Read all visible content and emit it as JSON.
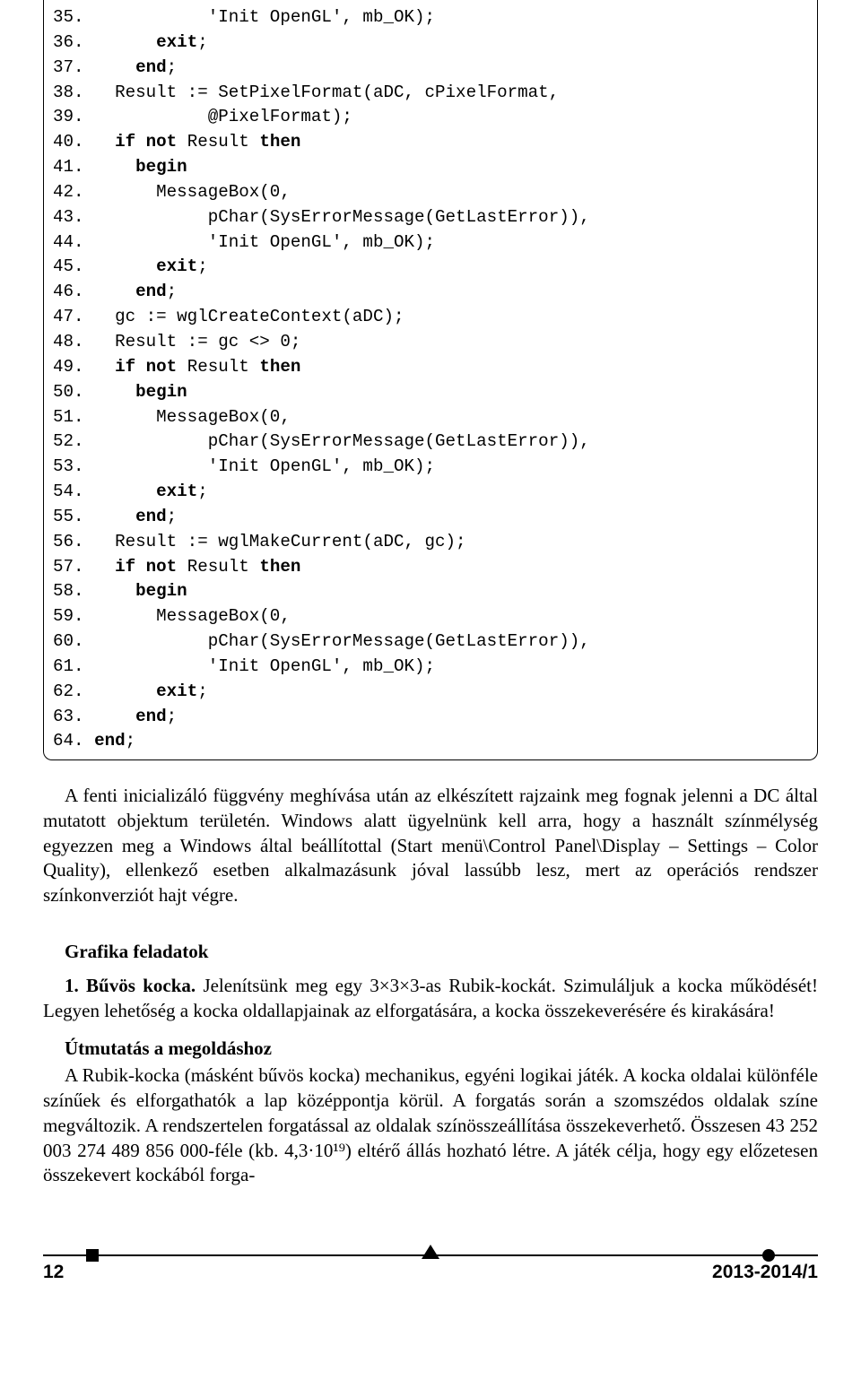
{
  "code": {
    "lines": [
      {
        "n": "35.",
        "i": "            ",
        "t": "'Init OpenGL', mb_OK);"
      },
      {
        "n": "36.",
        "i": "       ",
        "k": "exit",
        "t": ";"
      },
      {
        "n": "37.",
        "i": "     ",
        "k": "end",
        "t": ";"
      },
      {
        "n": "38.",
        "i": "   ",
        "t": "Result := SetPixelFormat(aDC, cPixelFormat,"
      },
      {
        "n": "39.",
        "i": "            ",
        "t": "@PixelFormat);"
      },
      {
        "n": "40.",
        "i": "   ",
        "pre": "if not ",
        "mid": "Result ",
        "k": "then"
      },
      {
        "n": "41.",
        "i": "     ",
        "k": "begin"
      },
      {
        "n": "42.",
        "i": "       ",
        "t": "MessageBox(0,"
      },
      {
        "n": "43.",
        "i": "            ",
        "t": "pChar(SysErrorMessage(GetLastError)),"
      },
      {
        "n": "44.",
        "i": "            ",
        "t": "'Init OpenGL', mb_OK);"
      },
      {
        "n": "45.",
        "i": "       ",
        "k": "exit",
        "t": ";"
      },
      {
        "n": "46.",
        "i": "     ",
        "k": "end",
        "t": ";"
      },
      {
        "n": "47.",
        "i": "   ",
        "t": "gc := wglCreateContext(aDC);"
      },
      {
        "n": "48.",
        "i": "   ",
        "t": "Result := gc <> 0;"
      },
      {
        "n": "49.",
        "i": "   ",
        "pre": "if not ",
        "mid": "Result ",
        "k": "then"
      },
      {
        "n": "50.",
        "i": "     ",
        "k": "begin"
      },
      {
        "n": "51.",
        "i": "       ",
        "t": "MessageBox(0,"
      },
      {
        "n": "52.",
        "i": "            ",
        "t": "pChar(SysErrorMessage(GetLastError)),"
      },
      {
        "n": "53.",
        "i": "            ",
        "t": "'Init OpenGL', mb_OK);"
      },
      {
        "n": "54.",
        "i": "       ",
        "k": "exit",
        "t": ";"
      },
      {
        "n": "55.",
        "i": "     ",
        "k": "end",
        "t": ";"
      },
      {
        "n": "56.",
        "i": "   ",
        "t": "Result := wglMakeCurrent(aDC, gc);"
      },
      {
        "n": "57.",
        "i": "   ",
        "pre": "if not ",
        "mid": "Result ",
        "k": "then"
      },
      {
        "n": "58.",
        "i": "     ",
        "k": "begin"
      },
      {
        "n": "59.",
        "i": "       ",
        "t": "MessageBox(0,"
      },
      {
        "n": "60.",
        "i": "            ",
        "t": "pChar(SysErrorMessage(GetLastError)),"
      },
      {
        "n": "61.",
        "i": "            ",
        "t": "'Init OpenGL', mb_OK);"
      },
      {
        "n": "62.",
        "i": "       ",
        "k": "exit",
        "t": ";"
      },
      {
        "n": "63.",
        "i": "     ",
        "k": "end",
        "t": ";"
      },
      {
        "n": "64.",
        "i": " ",
        "k": "end",
        "t": ";"
      }
    ]
  },
  "para1": "A fenti inicializáló függvény meghívása után az elkészített rajzaink meg fognak jelenni a DC által mutatott objektum területén. Windows alatt ügyelnünk kell arra, hogy a használt színmélység egyezzen meg a Windows által beállítottal (Start menü\\Control Panel\\Display – Settings – Color Quality), ellenkező esetben alkalmazásunk jóval lassúbb lesz, mert az operációs rendszer színkonverziót hajt végre.",
  "section": "Grafika feladatok",
  "task_lead": "1. Bűvös kocka.",
  "task_rest": " Jelenítsünk meg egy 3×3×3-as Rubik-kockát. Szimuláljuk a kocka működését! Legyen lehetőség a kocka oldallapjainak az elforgatására, a kocka összekeverésére és kirakására!",
  "subhead": "Útmutatás a megoldáshoz",
  "body": "A Rubik-kocka (másként bűvös kocka) mechanikus, egyéni logikai játék. A kocka oldalai különféle színűek és elforgathatók a lap középpontja körül. A forgatás során a szomszédos oldalak színe megváltozik. A rendszertelen forgatással az oldalak színösszeállítása összekeverhető. Összesen 43 252 003 274 489 856 000-féle (kb. 4,3·10¹⁹) eltérő állás hozható létre. A játék célja, hogy egy előzetesen összekevert kockából forga-",
  "footer": {
    "page": "12",
    "issue": "2013-2014/1"
  }
}
